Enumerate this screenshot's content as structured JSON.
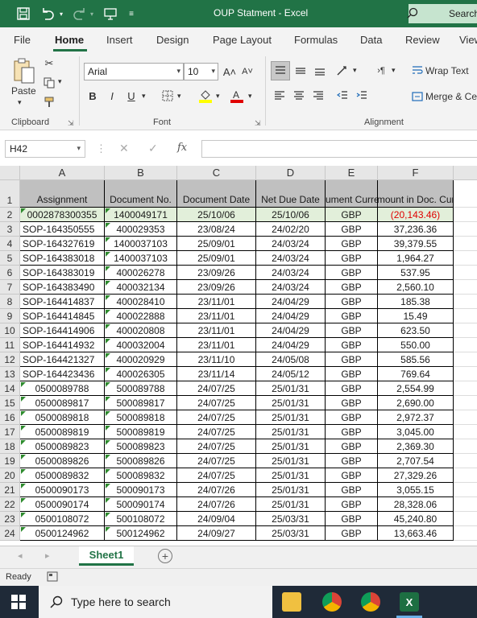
{
  "titlebar": {
    "title": "OUP Statment  -  Excel",
    "search_label": "Search"
  },
  "menu": {
    "tabs": [
      "File",
      "Home",
      "Insert",
      "Design",
      "Page Layout",
      "Formulas",
      "Data",
      "Review",
      "View"
    ]
  },
  "ribbon": {
    "paste_label": "Paste",
    "font_name": "Arial",
    "font_size": "10",
    "grow_font": "A˄",
    "shrink_font": "A˅",
    "bold": "B",
    "italic": "I",
    "underline": "U",
    "wrap_text": "Wrap Text",
    "merge_center": "Merge & Ce",
    "groups": {
      "clipboard": "Clipboard",
      "font": "Font",
      "alignment": "Alignment"
    }
  },
  "formula_bar": {
    "name_box": "H42",
    "fx": "fx",
    "value": ""
  },
  "columns": [
    "A",
    "B",
    "C",
    "D",
    "E",
    "F"
  ],
  "headers": [
    "Assignment",
    "Document No.",
    "Document Date",
    "Net Due Date",
    "Document Currency",
    "Amount in Doc. Curr."
  ],
  "rows": [
    {
      "num": "1"
    },
    {
      "num": "2",
      "cells": [
        "0002878300355",
        "1400049171",
        "25/10/06",
        "25/10/06",
        "GBP",
        "(20,143.46)"
      ]
    },
    {
      "num": "3",
      "cells": [
        "SOP-164350555",
        "400029353",
        "23/08/24",
        "24/02/20",
        "GBP",
        "37,236.36"
      ]
    },
    {
      "num": "4",
      "cells": [
        "SOP-164327619",
        "1400037103",
        "25/09/01",
        "24/03/24",
        "GBP",
        "39,379.55"
      ]
    },
    {
      "num": "5",
      "cells": [
        "SOP-164383018",
        "1400037103",
        "25/09/01",
        "24/03/24",
        "GBP",
        "1,964.27"
      ]
    },
    {
      "num": "6",
      "cells": [
        "SOP-164383019",
        "400026278",
        "23/09/26",
        "24/03/24",
        "GBP",
        "537.95"
      ]
    },
    {
      "num": "7",
      "cells": [
        "SOP-164383490",
        "400032134",
        "23/09/26",
        "24/03/24",
        "GBP",
        "2,560.10"
      ]
    },
    {
      "num": "8",
      "cells": [
        "SOP-164414837",
        "400028410",
        "23/11/01",
        "24/04/29",
        "GBP",
        "185.38"
      ]
    },
    {
      "num": "9",
      "cells": [
        "SOP-164414845",
        "400022888",
        "23/11/01",
        "24/04/29",
        "GBP",
        "15.49"
      ]
    },
    {
      "num": "10",
      "cells": [
        "SOP-164414906",
        "400020808",
        "23/11/01",
        "24/04/29",
        "GBP",
        "623.50"
      ]
    },
    {
      "num": "11",
      "cells": [
        "SOP-164414932",
        "400032004",
        "23/11/01",
        "24/04/29",
        "GBP",
        "550.00"
      ]
    },
    {
      "num": "12",
      "cells": [
        "SOP-164421327",
        "400020929",
        "23/11/10",
        "24/05/08",
        "GBP",
        "585.56"
      ]
    },
    {
      "num": "13",
      "cells": [
        "SOP-164423436",
        "400026305",
        "23/11/14",
        "24/05/12",
        "GBP",
        "769.64"
      ]
    },
    {
      "num": "14",
      "cells": [
        "0500089788",
        "500089788",
        "24/07/25",
        "25/01/31",
        "GBP",
        "2,554.99"
      ]
    },
    {
      "num": "15",
      "cells": [
        "0500089817",
        "500089817",
        "24/07/25",
        "25/01/31",
        "GBP",
        "2,690.00"
      ]
    },
    {
      "num": "16",
      "cells": [
        "0500089818",
        "500089818",
        "24/07/25",
        "25/01/31",
        "GBP",
        "2,972.37"
      ]
    },
    {
      "num": "17",
      "cells": [
        "0500089819",
        "500089819",
        "24/07/25",
        "25/01/31",
        "GBP",
        "3,045.00"
      ]
    },
    {
      "num": "18",
      "cells": [
        "0500089823",
        "500089823",
        "24/07/25",
        "25/01/31",
        "GBP",
        "2,369.30"
      ]
    },
    {
      "num": "19",
      "cells": [
        "0500089826",
        "500089826",
        "24/07/25",
        "25/01/31",
        "GBP",
        "2,707.54"
      ]
    },
    {
      "num": "20",
      "cells": [
        "0500089832",
        "500089832",
        "24/07/25",
        "25/01/31",
        "GBP",
        "27,329.26"
      ]
    },
    {
      "num": "21",
      "cells": [
        "0500090173",
        "500090173",
        "24/07/26",
        "25/01/31",
        "GBP",
        "3,055.15"
      ]
    },
    {
      "num": "22",
      "cells": [
        "0500090174",
        "500090174",
        "24/07/26",
        "25/01/31",
        "GBP",
        "28,328.06"
      ]
    },
    {
      "num": "23",
      "cells": [
        "0500108072",
        "500108072",
        "24/09/04",
        "25/03/31",
        "GBP",
        "45,240.80"
      ]
    },
    {
      "num": "24",
      "cells": [
        "0500124962",
        "500124962",
        "24/09/27",
        "25/03/31",
        "GBP",
        "13,663.46"
      ]
    }
  ],
  "sheet_tab": "Sheet1",
  "status": "Ready",
  "taskbar": {
    "search_placeholder": "Type here to search"
  },
  "colors": {
    "accent": "#217346",
    "header_fill": "#c0c0c0",
    "highlight_row": "#e2efda",
    "negative": "#e00000"
  }
}
